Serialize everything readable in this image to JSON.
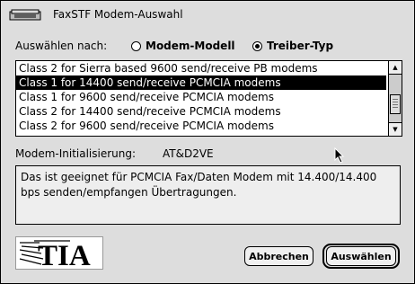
{
  "window": {
    "title": "FaxSTF Modem-Auswahl"
  },
  "search": {
    "label": "Auswählen nach:",
    "options": [
      {
        "label": "Modem-Modell",
        "selected": false
      },
      {
        "label": "Treiber-Typ",
        "selected": true
      }
    ]
  },
  "list": {
    "items": [
      "Class 2 for Sierra based 9600 send/receive PB modems",
      "Class 1 for 14400 send/receive PCMCIA modems",
      "Class 1 for 9600 send/receive PCMCIA modems",
      "Class 2 for 14400 send/receive PCMCIA modems",
      "Class 2 for 9600 send/receive PCMCIA modems"
    ],
    "selected_index": 1
  },
  "init": {
    "label": "Modem-Initialisierung:",
    "value": "AT&D2VE"
  },
  "description": "Das ist geeignet für PCMCIA Fax/Daten Modem mit 14.400/14.400 bps senden/empfangen Übertragungen.",
  "logo": {
    "text": "TIA"
  },
  "buttons": {
    "cancel": "Abbrechen",
    "select": "Auswählen"
  },
  "icons": {
    "window": "modem-icon",
    "cursor": "arrow-cursor-icon"
  }
}
